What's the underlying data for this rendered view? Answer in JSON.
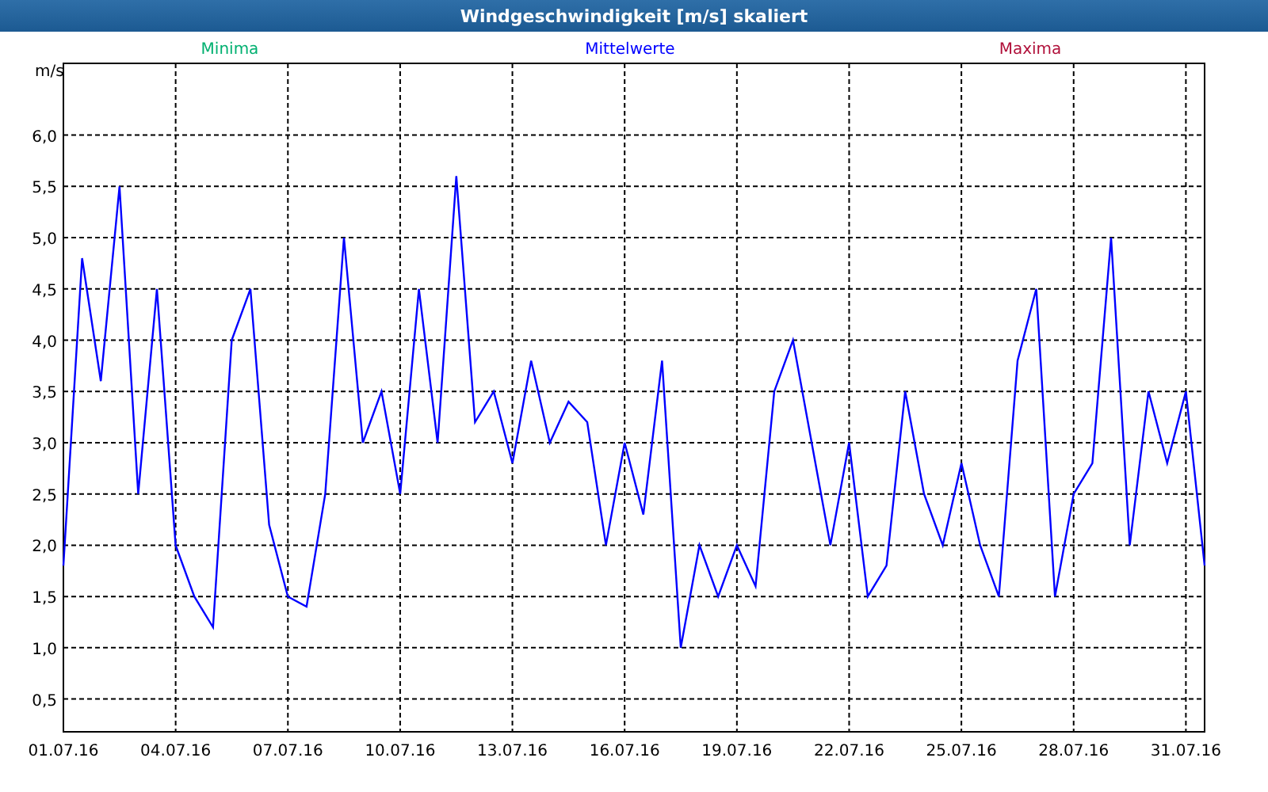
{
  "window": {
    "title": "Windgeschwindigkeit [m/s] skaliert"
  },
  "chart": {
    "legend_left": {
      "label": "Minima",
      "color": "#00b070"
    },
    "legend_right": {
      "label": "Maxima",
      "color": "#b0103a"
    },
    "chart_data": {
      "type": "line",
      "ylabel": "m/s",
      "grid": true,
      "ylim": [
        0.18,
        6.7
      ],
      "categories": [
        "01.07.16",
        null,
        null,
        null,
        null,
        null,
        "04.07.16",
        null,
        null,
        null,
        null,
        null,
        "07.07.16",
        null,
        null,
        null,
        null,
        null,
        "10.07.16",
        null,
        null,
        null,
        null,
        null,
        "13.07.16",
        null,
        null,
        null,
        null,
        null,
        "16.07.16",
        null,
        null,
        null,
        null,
        null,
        "19.07.16",
        null,
        null,
        null,
        null,
        null,
        "22.07.16",
        null,
        null,
        null,
        null,
        null,
        "25.07.16",
        null,
        null,
        null,
        null,
        null,
        "28.07.16",
        null,
        null,
        null,
        null,
        null,
        "31.07.16",
        null
      ],
      "series": [
        {
          "name": "Mittelwerte",
          "color": "#0000ff",
          "values": [
            1.8,
            4.8,
            3.6,
            5.5,
            2.5,
            4.5,
            2.0,
            1.5,
            1.2,
            4.0,
            4.5,
            2.2,
            1.5,
            1.4,
            2.5,
            5.0,
            3.0,
            3.5,
            2.5,
            4.5,
            3.0,
            5.6,
            3.2,
            3.5,
            2.8,
            3.8,
            3.0,
            3.4,
            3.2,
            2.0,
            3.0,
            2.3,
            3.8,
            1.0,
            2.0,
            1.5,
            2.0,
            1.6,
            3.5,
            4.0,
            3.0,
            2.0,
            3.0,
            1.5,
            1.8,
            3.5,
            2.5,
            2.0,
            2.8,
            2.0,
            1.5,
            3.8,
            4.5,
            1.5,
            2.5,
            2.8,
            5.0,
            2.0,
            3.5,
            2.8,
            3.5,
            1.8
          ]
        }
      ],
      "yticks": [
        {
          "value": 0.5,
          "label": "0,5"
        },
        {
          "value": 1,
          "label": "1,0"
        },
        {
          "value": 1.5,
          "label": "1,5"
        },
        {
          "value": 2,
          "label": "2,0"
        },
        {
          "value": 2.5,
          "label": "2,5"
        },
        {
          "value": 3,
          "label": "3,0"
        },
        {
          "value": 3.5,
          "label": "3,5"
        },
        {
          "value": 4,
          "label": "4,0"
        },
        {
          "value": 4.5,
          "label": "4,5"
        },
        {
          "value": 5,
          "label": "5,0"
        },
        {
          "value": 5.5,
          "label": "5,5"
        },
        {
          "value": 6,
          "label": "6,0"
        }
      ]
    }
  }
}
